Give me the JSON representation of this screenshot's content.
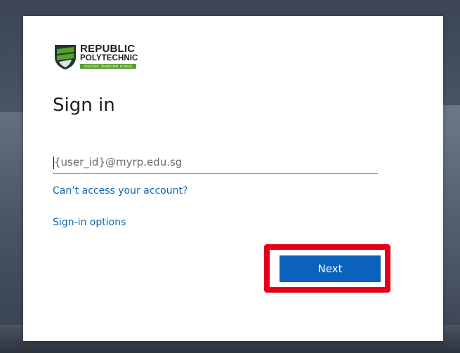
{
  "branding": {
    "name_line1": "REPUBLIC",
    "name_line2": "POLYTECHNIC",
    "tagline": "DISCOVER. TRANSFORM. ACHIEVE",
    "colors": {
      "shield_dark": "#1e3a2a",
      "shield_green": "#5aa02c",
      "tagline_bg": "#5aa02c"
    }
  },
  "signin": {
    "title": "Sign in",
    "email_placeholder": "{user_id}@myrp.edu.sg",
    "email_value": "",
    "cant_access_link": "Can’t access your account?",
    "signin_options_link": "Sign-in options",
    "next_button": "Next"
  },
  "annotation": {
    "highlight_color": "#e5001a",
    "highlight_target": "next-button"
  },
  "colors": {
    "accent": "#0b62bd",
    "link": "#0b67b2",
    "card_bg": "#ffffff"
  }
}
